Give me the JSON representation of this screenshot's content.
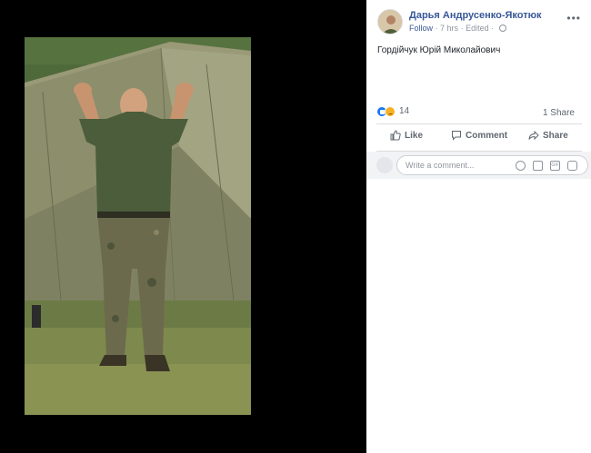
{
  "post": {
    "author": "Дарья Андрусенко-Якотюк",
    "follow_label": "Follow",
    "time": "7 hrs",
    "edited": "Edited",
    "text": "Гордійчук Юрій Миколайович",
    "reaction_count": "14",
    "shares": "1 Share",
    "like_label": "Like",
    "comment_label": "Comment",
    "share_label": "Share",
    "comment_placeholder": "Write a comment..."
  },
  "icons": {
    "more": "more-horizontal-icon",
    "privacy": "globe-icon",
    "reaction_like": "like-reaction-icon",
    "reaction_sad": "sad-reaction-icon",
    "emoji": "emoji-icon",
    "camera": "camera-icon",
    "gif": "gif-icon",
    "sticker": "sticker-icon"
  },
  "colors": {
    "link": "#385898",
    "muted": "#90949c",
    "action": "#606770",
    "background": "#000000"
  }
}
